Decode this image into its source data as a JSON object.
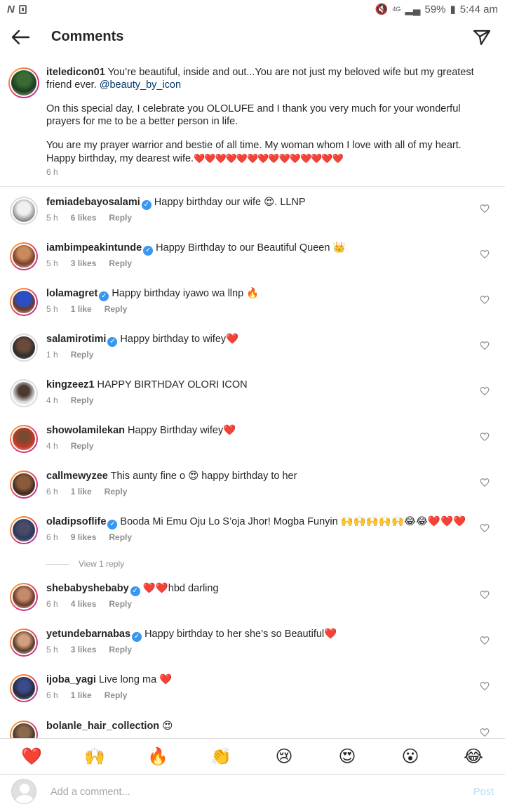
{
  "status_bar": {
    "left_icon": "N",
    "network": "4G",
    "battery": "59%",
    "time": "5:44 am"
  },
  "header": {
    "title": "Comments"
  },
  "caption": {
    "username": "iteledicon01",
    "text_1": " You’re beautiful, inside and out...You are not just my beloved wife but my greatest friend ever. ",
    "mention": "@beauty_by_icon",
    "text_2": "On this special day, I celebrate you OLOLUFE and I thank you very much for your wonderful prayers for me to be a better person in life.",
    "text_3": "You are my prayer warrior and bestie of all time. My woman whom I love with all of my heart. Happy birthday, my dearest wife.",
    "text_3_hearts": "❤️❤️❤️❤️❤️❤️❤️❤️❤️❤️❤️❤️❤️❤️",
    "time": "6 h"
  },
  "comments": [
    {
      "username": "femiadebayosalami",
      "verified": true,
      "text": "Happy birthday our wife 😍. LLNP",
      "time": "5 h",
      "likes": "6 likes",
      "reply": "Reply"
    },
    {
      "username": "iambimpeakintunde",
      "verified": true,
      "text": "Happy Birthday to our Beautiful Queen 👑",
      "time": "5 h",
      "likes": "3 likes",
      "reply": "Reply"
    },
    {
      "username": "lolamagret",
      "verified": true,
      "text": "Happy birthday iyawo wa llnp 🔥",
      "time": "5 h",
      "likes": "1 like",
      "reply": "Reply"
    },
    {
      "username": "salamirotimi",
      "verified": true,
      "text": "Happy birthday to wifey❤️",
      "time": "1 h",
      "likes": "",
      "reply": "Reply"
    },
    {
      "username": "kingzeez1",
      "verified": false,
      "text": "HAPPY BIRTHDAY OLORI ICON",
      "time": "4 h",
      "likes": "",
      "reply": "Reply"
    },
    {
      "username": "showolamilekan",
      "verified": false,
      "text": "Happy Birthday wifey❤️",
      "time": "4 h",
      "likes": "",
      "reply": "Reply"
    },
    {
      "username": "callmewyzee",
      "verified": false,
      "text": "This aunty fine o 😍 happy birthday to her",
      "time": "6 h",
      "likes": "1 like",
      "reply": "Reply"
    },
    {
      "username": "oladipsoflife",
      "verified": true,
      "text": "Booda Mi Emu Oju Lo S’oja Jhor! Mogba Funyin 🙌🙌🙌🙌🙌😂😂❤️❤️❤️",
      "time": "6 h",
      "likes": "9 likes",
      "reply": "Reply"
    },
    {
      "username": "shebabyshebaby",
      "verified": true,
      "text": "❤️❤️hbd darling",
      "time": "6 h",
      "likes": "4 likes",
      "reply": "Reply"
    },
    {
      "username": "yetundebarnabas",
      "verified": true,
      "text": "Happy birthday to her she’s so Beautiful❤️",
      "time": "5 h",
      "likes": "3 likes",
      "reply": "Reply"
    },
    {
      "username": "ijoba_yagi",
      "verified": false,
      "text": "Live long ma ❤️",
      "time": "6 h",
      "likes": "1 like",
      "reply": "Reply"
    },
    {
      "username": "bolanle_hair_collection",
      "verified": false,
      "text": "😍",
      "time": "",
      "likes": "",
      "reply": ""
    }
  ],
  "view_reply": "View 1 reply",
  "emoji_bar": [
    "❤️",
    "🙌",
    "🔥",
    "👏",
    "😢",
    "😍",
    "😮",
    "😂"
  ],
  "input": {
    "placeholder": "Add a comment...",
    "post_label": "Post"
  }
}
